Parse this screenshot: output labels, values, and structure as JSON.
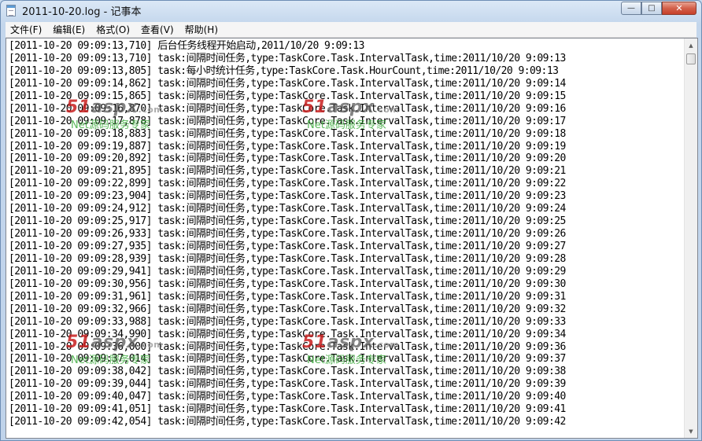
{
  "window": {
    "title": "2011-10-20.log - 记事本",
    "buttons": {
      "minimize": "—",
      "maximize": "□",
      "close": "✕"
    }
  },
  "menu": [
    "文件(F)",
    "编辑(E)",
    "格式(O)",
    "查看(V)",
    "帮助(H)"
  ],
  "watermark": {
    "logo": "51",
    "logo_mid": "aspx",
    "logo_suffix": ".com",
    "subtitle": "Net源码服务专家"
  },
  "lines": [
    "[2011-10-20 09:09:13,710] 后台任务线程开始启动,2011/10/20 9:09:13",
    "[2011-10-20 09:09:13,710] task:间隔时间任务,type:TaskCore.Task.IntervalTask,time:2011/10/20 9:09:13",
    "[2011-10-20 09:09:13,805] task:每小时统计任务,type:TaskCore.Task.HourCount,time:2011/10/20 9:09:13",
    "[2011-10-20 09:09:14,862] task:间隔时间任务,type:TaskCore.Task.IntervalTask,time:2011/10/20 9:09:14",
    "[2011-10-20 09:09:15,865] task:间隔时间任务,type:TaskCore.Task.IntervalTask,time:2011/10/20 9:09:15",
    "[2011-10-20 09:09:16,870] task:间隔时间任务,type:TaskCore.Task.IntervalTask,time:2011/10/20 9:09:16",
    "[2011-10-20 09:09:17,878] task:间隔时间任务,type:TaskCore.Task.IntervalTask,time:2011/10/20 9:09:17",
    "[2011-10-20 09:09:18,883] task:间隔时间任务,type:TaskCore.Task.IntervalTask,time:2011/10/20 9:09:18",
    "[2011-10-20 09:09:19,887] task:间隔时间任务,type:TaskCore.Task.IntervalTask,time:2011/10/20 9:09:19",
    "[2011-10-20 09:09:20,892] task:间隔时间任务,type:TaskCore.Task.IntervalTask,time:2011/10/20 9:09:20",
    "[2011-10-20 09:09:21,895] task:间隔时间任务,type:TaskCore.Task.IntervalTask,time:2011/10/20 9:09:21",
    "[2011-10-20 09:09:22,899] task:间隔时间任务,type:TaskCore.Task.IntervalTask,time:2011/10/20 9:09:22",
    "[2011-10-20 09:09:23,904] task:间隔时间任务,type:TaskCore.Task.IntervalTask,time:2011/10/20 9:09:23",
    "[2011-10-20 09:09:24,912] task:间隔时间任务,type:TaskCore.Task.IntervalTask,time:2011/10/20 9:09:24",
    "[2011-10-20 09:09:25,917] task:间隔时间任务,type:TaskCore.Task.IntervalTask,time:2011/10/20 9:09:25",
    "[2011-10-20 09:09:26,933] task:间隔时间任务,type:TaskCore.Task.IntervalTask,time:2011/10/20 9:09:26",
    "[2011-10-20 09:09:27,935] task:间隔时间任务,type:TaskCore.Task.IntervalTask,time:2011/10/20 9:09:27",
    "[2011-10-20 09:09:28,939] task:间隔时间任务,type:TaskCore.Task.IntervalTask,time:2011/10/20 9:09:28",
    "[2011-10-20 09:09:29,941] task:间隔时间任务,type:TaskCore.Task.IntervalTask,time:2011/10/20 9:09:29",
    "[2011-10-20 09:09:30,956] task:间隔时间任务,type:TaskCore.Task.IntervalTask,time:2011/10/20 9:09:30",
    "[2011-10-20 09:09:31,961] task:间隔时间任务,type:TaskCore.Task.IntervalTask,time:2011/10/20 9:09:31",
    "[2011-10-20 09:09:32,966] task:间隔时间任务,type:TaskCore.Task.IntervalTask,time:2011/10/20 9:09:32",
    "[2011-10-20 09:09:33,988] task:间隔时间任务,type:TaskCore.Task.IntervalTask,time:2011/10/20 9:09:33",
    "[2011-10-20 09:09:34,990] task:间隔时间任务,type:TaskCore.Task.IntervalTask,time:2011/10/20 9:09:34",
    "[2011-10-20 09:09:36,000] task:间隔时间任务,type:TaskCore.Task.IntervalTask,time:2011/10/20 9:09:36",
    "[2011-10-20 09:09:37,014] task:间隔时间任务,type:TaskCore.Task.IntervalTask,time:2011/10/20 9:09:37",
    "[2011-10-20 09:09:38,042] task:间隔时间任务,type:TaskCore.Task.IntervalTask,time:2011/10/20 9:09:38",
    "[2011-10-20 09:09:39,044] task:间隔时间任务,type:TaskCore.Task.IntervalTask,time:2011/10/20 9:09:39",
    "[2011-10-20 09:09:40,047] task:间隔时间任务,type:TaskCore.Task.IntervalTask,time:2011/10/20 9:09:40",
    "[2011-10-20 09:09:41,051] task:间隔时间任务,type:TaskCore.Task.IntervalTask,time:2011/10/20 9:09:41",
    "[2011-10-20 09:09:42,054] task:间隔时间任务,type:TaskCore.Task.IntervalTask,time:2011/10/20 9:09:42"
  ]
}
